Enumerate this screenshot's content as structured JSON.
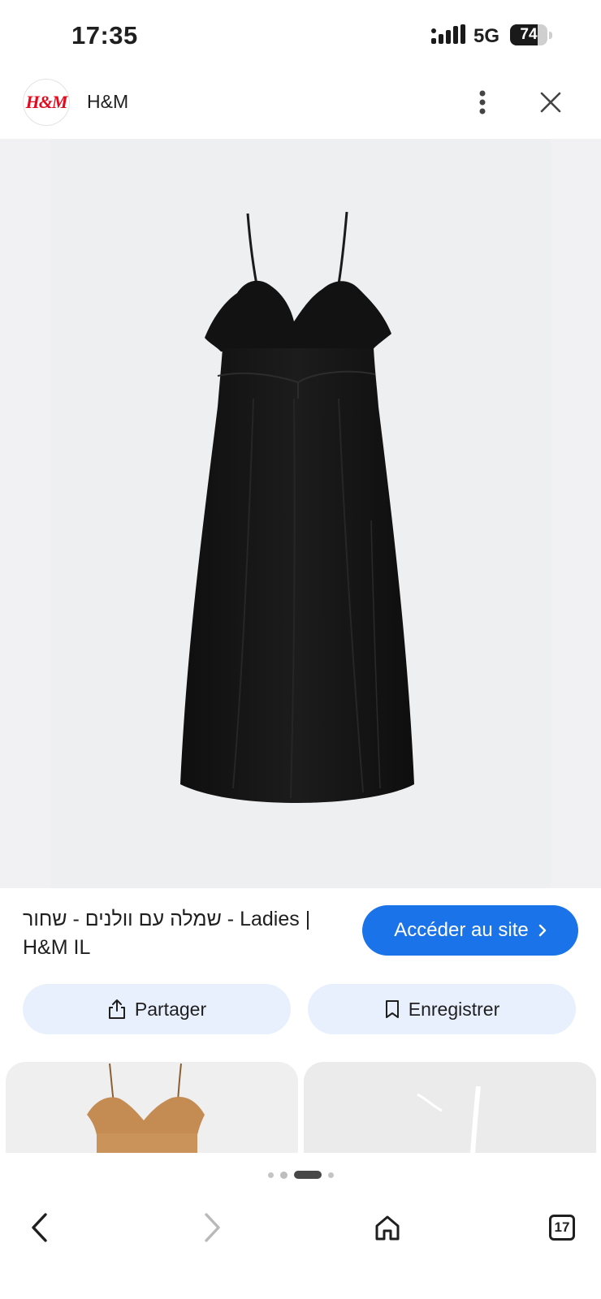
{
  "status_bar": {
    "time": "17:35",
    "network": "5G",
    "battery": "74",
    "battery_level": 0.74
  },
  "header": {
    "logo_text": "H&M",
    "site_name": "H&M"
  },
  "product": {
    "title_rtl": "שמלה עם וולנים - שחור",
    "title_ltr_part": " - Ladies | H&M IL",
    "visit_label": "Accéder au site"
  },
  "actions": {
    "share_label": "Partager",
    "save_label": "Enregistrer"
  },
  "pagination": {
    "dots": 4,
    "active_index": 2
  },
  "bottom_nav": {
    "tab_count": "17"
  },
  "colors": {
    "accent": "#1a73e8",
    "pill_bg": "#e8f0fe",
    "logo_red": "#e4091c",
    "dress": "#151515",
    "thumb_dress": "#c9935a"
  }
}
